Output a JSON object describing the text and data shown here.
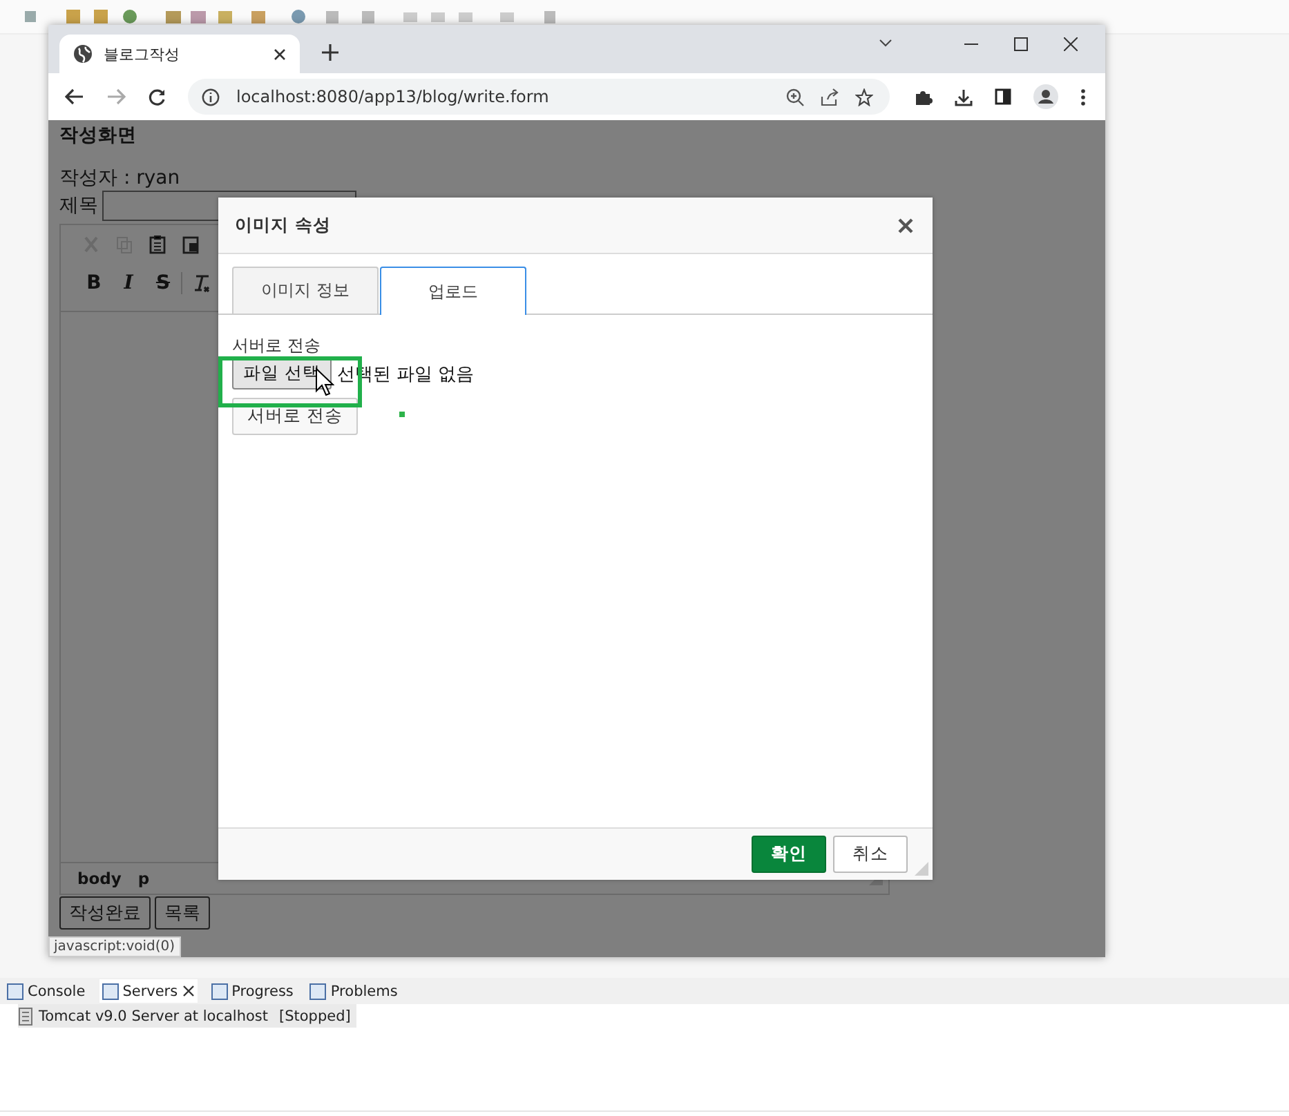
{
  "browser": {
    "tab": {
      "title": "블로그작성"
    },
    "url": "localhost:8080/app13/blog/write.form"
  },
  "page": {
    "heading": "작성화면",
    "author_label": "작성자 : ryan",
    "title_label": "제목",
    "editor_tools": [
      "B",
      "I",
      "S"
    ],
    "editor_path": [
      "body",
      "p"
    ],
    "buttons": [
      {
        "label": "작성완료"
      },
      {
        "label": "목록"
      }
    ],
    "status_tooltip": "javascript:void(0)"
  },
  "dialog": {
    "title": "이미지 속성",
    "tabs": [
      {
        "label": "이미지 정보",
        "selected": false
      },
      {
        "label": "업로드",
        "selected": true
      }
    ],
    "upload_label": "서버로 전송",
    "file_button": "파일 선택",
    "file_status": "선택된 파일 없음",
    "send_button": "서버로 전송",
    "buttons": [
      {
        "label": "확인",
        "kind": "primary"
      },
      {
        "label": "취소",
        "kind": "secondary"
      }
    ]
  },
  "eclipse_panel": {
    "tabs": [
      {
        "label": "Console",
        "selected": false
      },
      {
        "label": "Servers",
        "selected": true
      },
      {
        "label": "Progress",
        "selected": false
      },
      {
        "label": "Problems",
        "selected": false
      }
    ],
    "server": "Tomcat v9.0 Server at localhost",
    "server_state": "[Stopped]"
  }
}
